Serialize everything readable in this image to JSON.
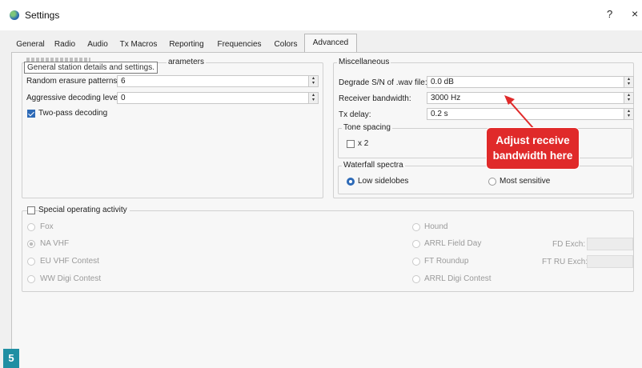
{
  "window": {
    "title": "Settings",
    "help_label": "?",
    "close_label": "×"
  },
  "tabs": [
    {
      "label": "General"
    },
    {
      "label": "Radio"
    },
    {
      "label": "Audio"
    },
    {
      "label": "Tx Macros"
    },
    {
      "label": "Reporting"
    },
    {
      "label": "Frequencies"
    },
    {
      "label": "Colors"
    },
    {
      "label": "Advanced",
      "active": true
    }
  ],
  "decoding": {
    "title_partial": "arameters",
    "tooltip": "General station details and settings.",
    "random_erasure": {
      "label": "Random erasure patterns:",
      "value": "6"
    },
    "aggressive": {
      "label": "Aggressive decoding level:",
      "value": "0"
    },
    "two_pass": {
      "label": "Two-pass decoding",
      "checked": true
    }
  },
  "misc": {
    "title": "Miscellaneous",
    "degrade": {
      "label": "Degrade S/N of .wav file:",
      "value": "0.0 dB"
    },
    "rx_bandwidth": {
      "label": "Receiver bandwidth:",
      "value": "3000 Hz"
    },
    "tx_delay": {
      "label": "Tx delay:",
      "value": "0.2 s"
    },
    "tone_spacing": {
      "title": "Tone spacing",
      "x2_label": "x 2",
      "checked": false
    },
    "waterfall": {
      "title": "Waterfall spectra",
      "low_sidelobes": "Low sidelobes",
      "most_sensitive": "Most sensitive",
      "selected": "Low sidelobes"
    }
  },
  "special": {
    "title": "Special operating activity",
    "checked": false,
    "left_options": [
      "Fox",
      "NA VHF",
      "EU VHF Contest",
      "WW Digi Contest"
    ],
    "right_options": [
      "Hound",
      "ARRL Field Day",
      "FT Roundup",
      "ARRL Digi Contest"
    ],
    "fd_exch_label": "FD Exch:",
    "ft_ru_exch_label": "FT RU Exch:"
  },
  "annotation": {
    "callout_line1": "Adjust receive",
    "callout_line2": "bandwidth here",
    "callout_color": "#e02a2a",
    "figure_number": "5",
    "badge_color": "#1f8fa3"
  },
  "icons": {
    "spin": "spinbox-arrows-icon",
    "arrow_up": "▴",
    "arrow_down": "▾"
  }
}
